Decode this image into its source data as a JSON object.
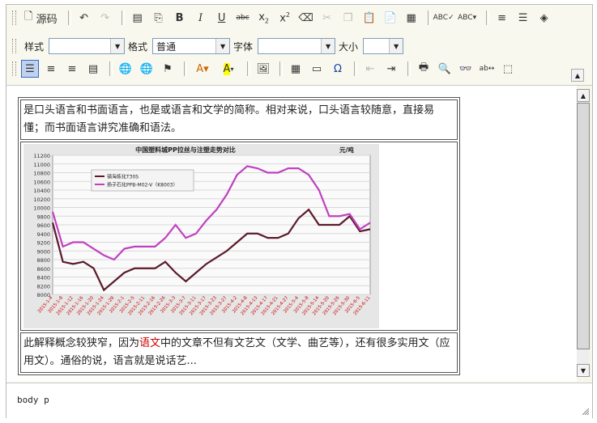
{
  "toolbar": {
    "source_label": "源码",
    "style_label": "样式",
    "style_value": "",
    "format_label": "格式",
    "format_value": "普通",
    "font_label": "字体",
    "font_value": "",
    "size_label": "大小",
    "size_value": ""
  },
  "content": {
    "para1": "是口头语言和书面语言，也是或语言和文学的简称。相对来说，口头语言较随意，直接易懂；而书面语言讲究准确和语法。",
    "para2_before": "此解释概念较狭窄，因为",
    "para2_link": "语文",
    "para2_after": "中的文章不但有文艺文（文学、曲艺等），还有很多实用文（应用文）。通俗的说，语言就是说话艺..."
  },
  "chart_data": {
    "type": "line",
    "title": "中国塑料城PP拉丝与注塑走势对比",
    "unit": "元/吨",
    "ylim": [
      8000,
      11200
    ],
    "y_ticks": [
      8000,
      8200,
      8400,
      8600,
      8800,
      9000,
      9200,
      9400,
      9600,
      9800,
      10000,
      10200,
      10400,
      10600,
      10800,
      11000,
      11200
    ],
    "x_labels": [
      "2015-1-4",
      "2015-1-8",
      "2015-1-12",
      "2015-1-16",
      "2015-1-20",
      "2015-1-24",
      "2015-1-28",
      "2015-2-1",
      "2015-2-5",
      "2015-2-11",
      "2015-2-16",
      "2015-2-26",
      "2015-3-3",
      "2015-3-7",
      "2015-3-11",
      "2015-3-17",
      "2015-3-23",
      "2015-3-27",
      "2015-4-2",
      "2015-4-8",
      "2015-4-13",
      "2015-4-17",
      "2015-4-21",
      "2015-4-27",
      "2015-5-4",
      "2015-5-8",
      "2015-5-14",
      "2015-5-20",
      "2015-5-26",
      "2015-5-30",
      "2015-6-5",
      "2015-6-11"
    ],
    "series": [
      {
        "name": "镇海炼化T30S",
        "color": "#5a1a2a",
        "values": [
          9650,
          8750,
          8700,
          8750,
          8600,
          8100,
          8300,
          8500,
          8600,
          8600,
          8600,
          8750,
          8500,
          8300,
          8500,
          8700,
          8850,
          9000,
          9200,
          9400,
          9400,
          9300,
          9300,
          9400,
          9750,
          9950,
          9600,
          9600,
          9600,
          9800,
          9450,
          9500
        ]
      },
      {
        "name": "扬子石化PPB-M02-V（K8003）",
        "color": "#c040c0",
        "values": [
          9900,
          9100,
          9200,
          9200,
          9050,
          8900,
          8800,
          9050,
          9100,
          9100,
          9100,
          9300,
          9600,
          9300,
          9400,
          9700,
          9950,
          10300,
          10750,
          10950,
          10900,
          10800,
          10800,
          10900,
          10900,
          10750,
          10400,
          9800,
          9800,
          9850,
          9500,
          9650
        ]
      }
    ]
  },
  "status": {
    "path": "body  p"
  }
}
